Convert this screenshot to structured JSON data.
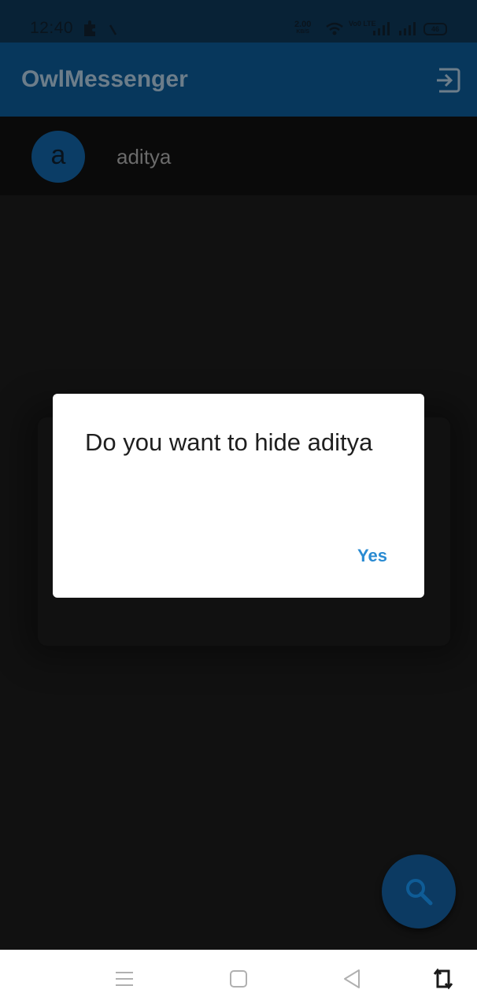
{
  "status_bar": {
    "time": "12:40",
    "net_speed": "2.00",
    "net_unit": "KB/S",
    "volte": "Vo0 LTE",
    "battery": "46",
    "icons": [
      "puzzle-icon",
      "tick-icon",
      "wifi-icon",
      "signal-icon",
      "signal-icon",
      "battery-icon"
    ]
  },
  "app_bar": {
    "title": "OwlMessenger",
    "logout_icon": "logout-icon"
  },
  "contacts": [
    {
      "initial": "a",
      "name": "aditya"
    }
  ],
  "dialog": {
    "message": "Do you want to hide aditya",
    "confirm_label": "Yes"
  },
  "fab": {
    "icon": "search-icon"
  },
  "nav_bar": {
    "icons": [
      "menu-icon",
      "home-icon",
      "back-icon",
      "rotate-icon"
    ]
  },
  "colors": {
    "app_bar": "#07375c",
    "status_bar": "#082236",
    "background": "#111111",
    "dialog_bg": "#ffffff",
    "accent": "#2a8bd2",
    "fab": "#0c3a62"
  }
}
